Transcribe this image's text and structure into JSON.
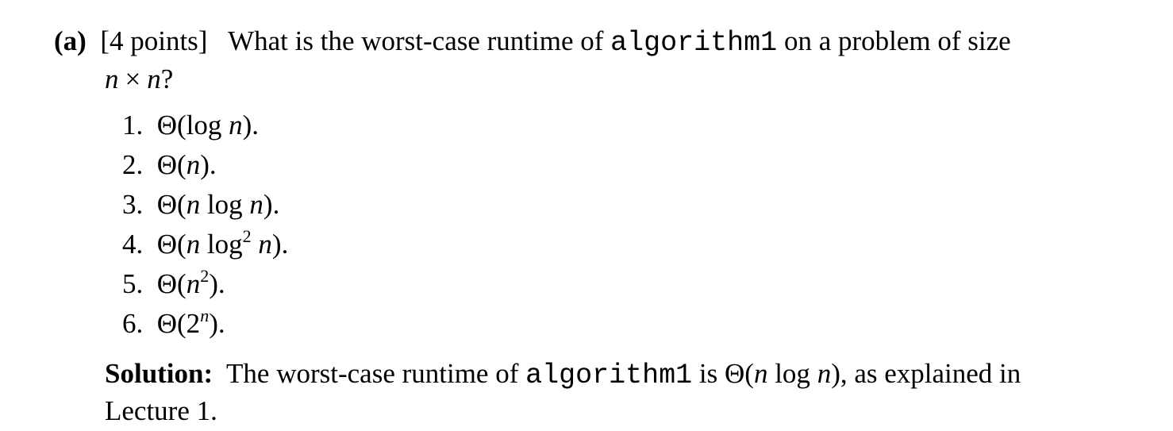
{
  "question": {
    "part_label": "(a)",
    "points": "[4 points]",
    "text_before_code": "What is the worst-case runtime of",
    "code_name": "algorithm1",
    "text_after_code": "on a problem of size",
    "size_n1": "n",
    "size_times": "×",
    "size_n2": "n",
    "size_qmark": "?"
  },
  "options": [
    {
      "num": "1.",
      "text": "Θ(log ",
      "var": "n",
      "tail": ")."
    },
    {
      "num": "2.",
      "text": "Θ(",
      "var": "n",
      "tail": ")."
    },
    {
      "num": "3.",
      "text": "Θ(",
      "var": "n",
      "mid": " log ",
      "var2": "n",
      "tail": ")."
    },
    {
      "num": "4.",
      "text": "Θ(",
      "var": "n",
      "mid": " log",
      "sup": "2",
      "mid2": " ",
      "var2": "n",
      "tail": ")."
    },
    {
      "num": "5.",
      "text": "Θ(",
      "var": "n",
      "sup": "2",
      "tail": ")."
    },
    {
      "num": "6.",
      "text": "Θ(2",
      "sup": "n",
      "tail": ")."
    }
  ],
  "solution": {
    "label": "Solution:",
    "text1": "The worst-case runtime of",
    "code_name": "algorithm1",
    "text2": "is Θ(",
    "var1": "n",
    "mid": " log ",
    "var2": "n",
    "text3": "), as explained in",
    "line2": "Lecture 1."
  }
}
